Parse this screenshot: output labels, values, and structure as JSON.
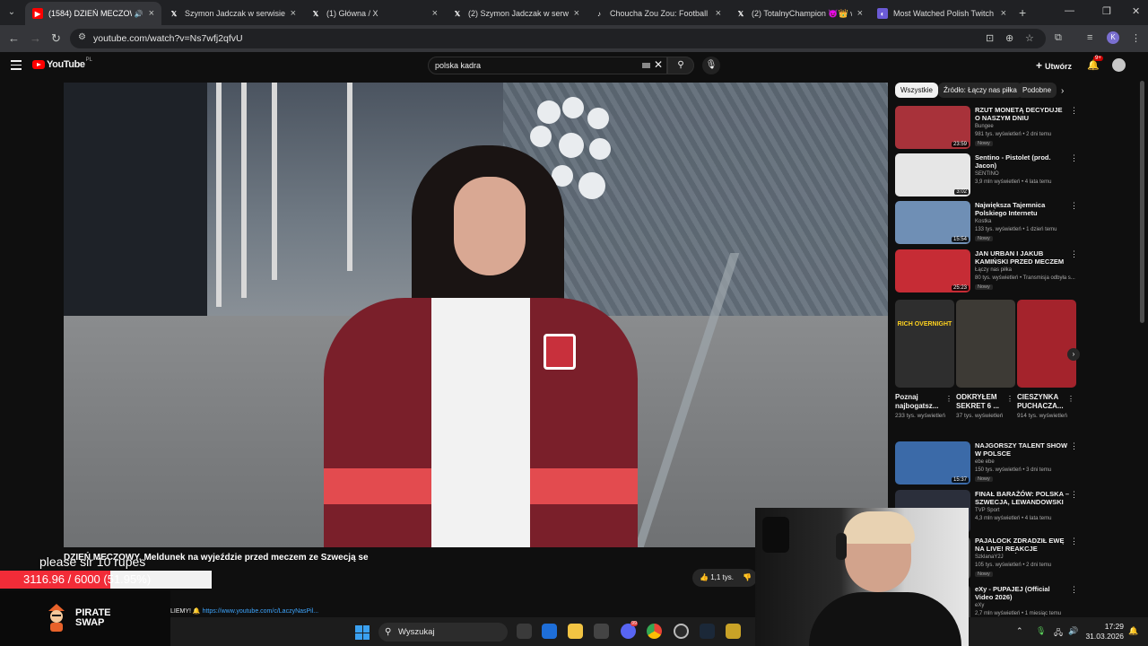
{
  "browser": {
    "tabs": [
      {
        "title": "(1584) DZIEŃ MECZOWY. M",
        "favicon": "youtube-icon",
        "active": true
      },
      {
        "title": "Szymon Jadczak w serwisie X:",
        "favicon": "x-icon",
        "active": false
      },
      {
        "title": "(1) Główna / X",
        "favicon": "x-icon",
        "active": false
      },
      {
        "title": "(2) Szymon Jadczak w serwisie",
        "favicon": "x-icon",
        "active": false
      },
      {
        "title": "Choucha Zou Zou: Football & F",
        "favicon": "tiktok-icon",
        "active": false
      },
      {
        "title": "(2) TotalnyChampion 😈👑 w",
        "favicon": "x-icon",
        "active": false
      },
      {
        "title": "Most Watched Polish Twitch St",
        "favicon": "chart-icon",
        "active": false
      }
    ],
    "url": "youtube.com/watch?v=Ns7wfj2qfvU",
    "profile_initial": "K"
  },
  "youtube": {
    "logo_text": "YouTube",
    "country_code": "PL",
    "search_query": "polska kadra",
    "create_label": "Utwórz",
    "notifications_badge": "9+",
    "video_title": "DZIEŃ MECZOWY. Meldunek na wyjeździe przed meczem ze Szwecją se",
    "like_count": "1,1 tys.",
    "description_prefix": "LIEMY! 🔔",
    "description_link": "https://www.youtube.com/c/LaczyNasPil..."
  },
  "sidebar": {
    "chips": [
      "Wszystkie",
      "Źródło: Łączy nas piłka",
      "Podobne"
    ],
    "recommendations_top": [
      {
        "title": "RZUT MONETĄ DECYDUJE O NASZYM DNIU",
        "channel": "Bungee",
        "meta": "981 tys. wyświetleń • 2 dni temu",
        "badge": "Nowy",
        "duration": "23:59",
        "thumb_color": "#a8323a"
      },
      {
        "title": "Sentino - Pistolet (prod. Jacon)",
        "channel": "SENTINO",
        "meta": "3,9 mln wyświetleń • 4 lata temu",
        "badge": "",
        "duration": "3:02",
        "thumb_color": "#e6e6e6"
      },
      {
        "title": "Największa Tajemnica Polskiego Internetu",
        "channel": "Kostka",
        "meta": "133 tys. wyświetleń • 1 dzień temu",
        "badge": "Nowy",
        "duration": "15:54",
        "thumb_color": "#6f8fb5"
      },
      {
        "title": "JAN URBAN I JAKUB KAMIŃSKI PRZED MECZEM ZE SZWECJĄ,...",
        "channel": "Łączy nas piłka",
        "meta": "80 tys. wyświetleń • Transmisja odbyła s...",
        "badge": "Nowy",
        "duration": "25:23",
        "thumb_color": "#c62c35"
      }
    ],
    "shorts": [
      {
        "title": "Poznaj najbogatsz...",
        "views": "233 tys. wyświetleń",
        "overlay": "RICH OVERNIGHT",
        "thumb_color": "#2e2e2e"
      },
      {
        "title": "ODKRYŁEM SEKRET 6 ...",
        "views": "37 tys. wyświetleń",
        "overlay": "",
        "thumb_color": "#3d3a35"
      },
      {
        "title": "CIESZYNKA PUCHACZA...",
        "views": "914 tys. wyświetleń",
        "overlay": "",
        "thumb_color": "#a4232c"
      }
    ],
    "recommendations_bottom": [
      {
        "title": "NAJGORSZY TALENT SHOW W POLSCE",
        "channel": "ebe ebe",
        "meta": "150 tys. wyświetleń • 3 dni temu",
        "badge": "Nowy",
        "duration": "15:37",
        "thumb_color": "#3b6aa8"
      },
      {
        "title": "FINAŁ BARAŻÓW: POLSKA – SZWECJA, LEWANDOWSKI ...",
        "channel": "TVP Sport",
        "meta": "4,3 mln wyświetleń • 4 lata temu",
        "badge": "",
        "duration": "",
        "thumb_color": "#2b2f3b"
      },
      {
        "title": "PAJALOCK ZDRADZIŁ EWĘ NA LIVE! REAKCJE STREAMERÓ...",
        "channel": "SzklanaY2J",
        "meta": "105 tys. wyświetleń • 2 dni temu",
        "badge": "Nowy",
        "duration": "",
        "thumb_color": "#4a4a4a"
      },
      {
        "title": "eXy - PUPAJEJ (Official Video 2026)",
        "channel": "eXy",
        "meta": "2,7 mln wyświetleń • 1 miesiąc temu",
        "badge": "",
        "duration": "",
        "thumb_color": "#3a3a3a"
      }
    ]
  },
  "overlay": {
    "tts_text": "please sir 10 rupes",
    "donation_text": "3116.96 / 6000 (51.95%)",
    "donation_fraction": 0.5195,
    "sponsor_name_line1": "PIRATE",
    "sponsor_name_line2": "SWAP"
  },
  "taskbar": {
    "search_label": "Wyszukaj",
    "time": "17:29",
    "date": "31.03.2026",
    "discord_badge": "99"
  }
}
